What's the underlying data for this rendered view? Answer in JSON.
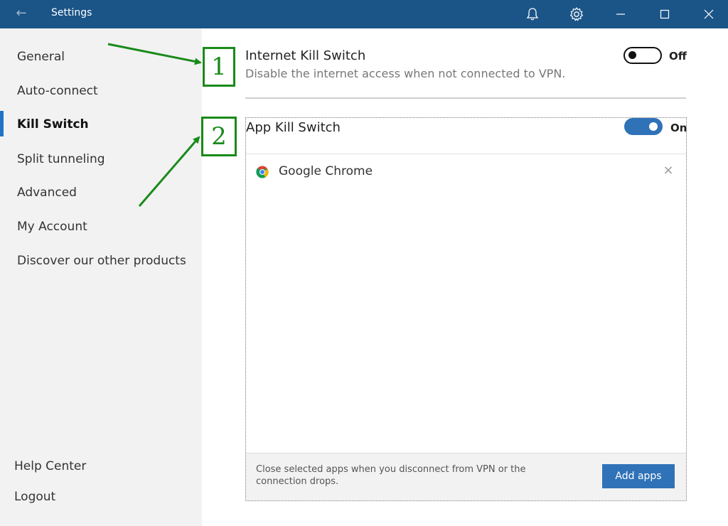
{
  "window": {
    "title": "Settings",
    "back_icon": "back-arrow-icon",
    "bell_icon": "bell-icon",
    "gear_icon": "gear-icon",
    "minimize_icon": "minimize-icon",
    "maximize_icon": "maximize-icon",
    "close_icon": "close-icon",
    "back_glyph": "←"
  },
  "sidebar": {
    "items": [
      {
        "label": "General"
      },
      {
        "label": "Auto-connect"
      },
      {
        "label": "Kill Switch",
        "active": true
      },
      {
        "label": "Split tunneling"
      },
      {
        "label": "Advanced"
      },
      {
        "label": "My Account"
      },
      {
        "label": "Discover our other products"
      }
    ],
    "bottom": [
      {
        "label": "Help Center"
      },
      {
        "label": "Logout"
      }
    ]
  },
  "internet_kill_switch": {
    "title": "Internet Kill Switch",
    "description": "Disable the internet access when not connected to VPN.",
    "state": "off",
    "state_label": "Off"
  },
  "app_kill_switch": {
    "title": "App Kill Switch",
    "state": "on",
    "state_label": "On",
    "apps": [
      {
        "name": "Google Chrome",
        "icon": "chrome-icon",
        "remove": "×"
      }
    ],
    "footer_text": "Close selected apps when you disconnect from VPN or the connection drops.",
    "add_button": "Add apps"
  },
  "annotations": [
    {
      "label": "1"
    },
    {
      "label": "2"
    }
  ],
  "colors": {
    "titlebar": "#1b5588",
    "accent": "#2f72b8",
    "annotation": "#1a8a1a",
    "sidebar_bg": "#f2f2f2"
  }
}
